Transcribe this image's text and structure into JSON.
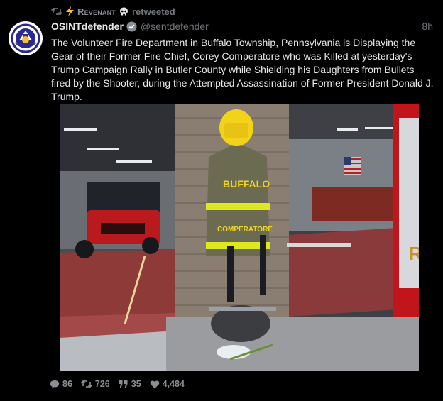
{
  "retweet": {
    "account_name": "Revenant",
    "label": "retweeted"
  },
  "tweet": {
    "display_name": "OSINTdefender",
    "handle": "@sentdefender",
    "time": "8h",
    "text": "The Volunteer Fire Department in Buffalo Township, Pennsylvania is Displaying the Gear of their Former Fire Chief, Corey Comperatore who was Killed at yesterday's Trump Campaign Rally in Butler County while Shielding his Daughters from Bullets fired by the Shooter, during the Attempted Assassination of Former President Donald J. Trump.",
    "media": {
      "jacket_text_top": "BUFFALO",
      "jacket_text_name": "COMPERATORE"
    }
  },
  "actions": {
    "replies": "86",
    "retweets": "726",
    "quotes": "35",
    "likes": "4,484"
  },
  "colors": {
    "background": "#000000",
    "text": "#e7e9ea",
    "muted": "#71767b",
    "accent_lightning": "#f7c22a"
  },
  "icons": [
    "retweet-icon",
    "lightning-icon",
    "skull-icon",
    "verified-icon",
    "reply-icon",
    "quote-icon",
    "heart-icon"
  ]
}
